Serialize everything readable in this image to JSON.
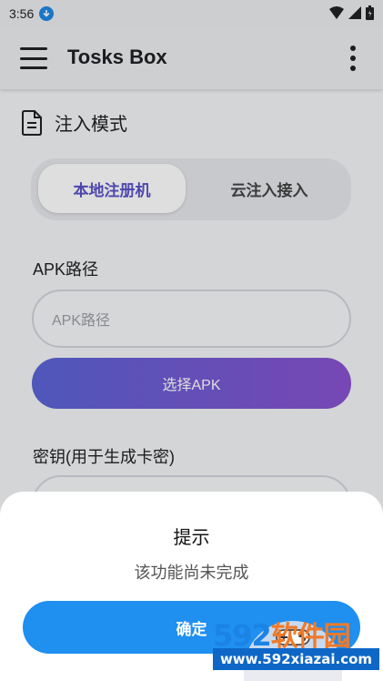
{
  "status_bar": {
    "time": "3:56"
  },
  "app_bar": {
    "title": "Tosks Box"
  },
  "section": {
    "title": "注入模式"
  },
  "mode_toggle": {
    "options": [
      "本地注册机",
      "云注入接入"
    ],
    "selected": "本地注册机"
  },
  "apk_field": {
    "label": "APK路径",
    "placeholder": "APK路径"
  },
  "select_apk_button": {
    "label": "选择APK"
  },
  "key_field": {
    "label": "密钥(用于生成卡密)"
  },
  "dialog": {
    "title": "提示",
    "message": "该功能尚未完成",
    "confirm_label": "确定"
  },
  "watermark": {
    "logo_num": "592",
    "logo_text": "软件园",
    "url": "www.592xiazai.com"
  },
  "colors": {
    "accent": "#5a52c9",
    "confirm": "#1f8ff0",
    "gradient_start": "#5b64d6",
    "gradient_end": "#8a52d0"
  }
}
